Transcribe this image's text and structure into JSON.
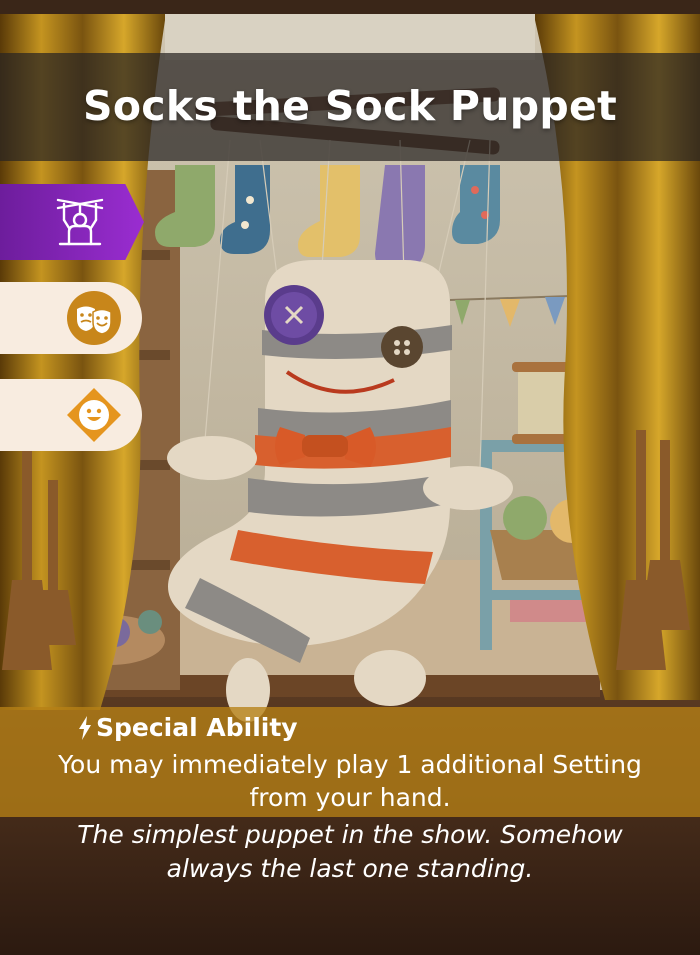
{
  "card": {
    "title": "Socks the Sock Puppet",
    "icons": {
      "role": "marionette-icon",
      "trait": "theater-masks-icon",
      "mood": "smiley-diamond-icon",
      "ability": "lightning-bolt-icon"
    },
    "colors": {
      "role_tab": "#8a26c0",
      "icon_gold": "#c8861a",
      "text_band": "#b68016",
      "tab_bg": "#f8ece0"
    },
    "ability": {
      "heading": "Special Ability",
      "text": "You may immediately play 1 additional Setting from your hand."
    },
    "flavor_text": "The simplest puppet in the show. Somehow always the last one standing."
  }
}
